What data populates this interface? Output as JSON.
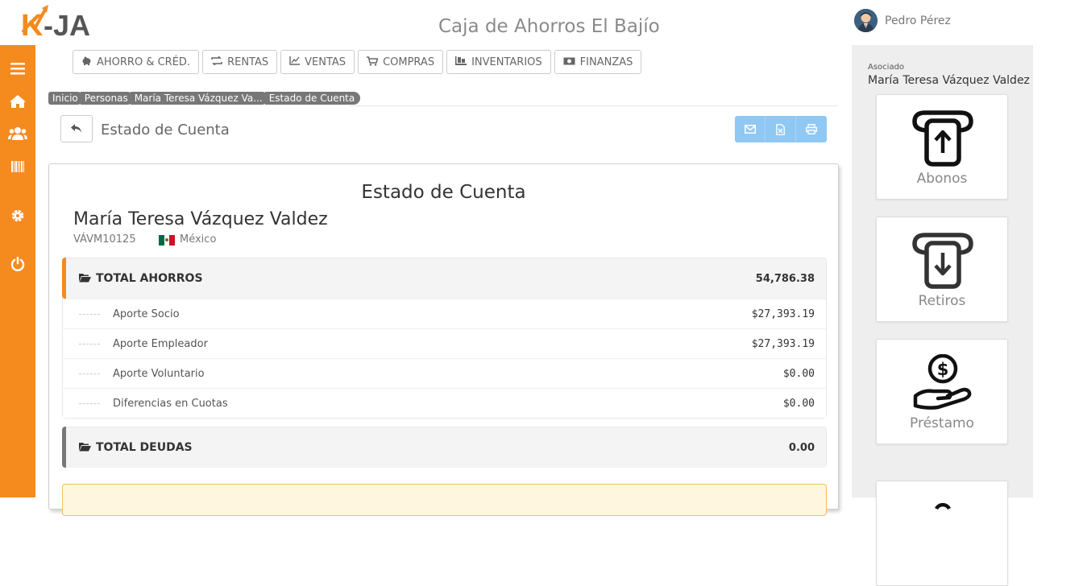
{
  "header": {
    "logo_text": "K-JA",
    "app_title": "Caja de Ahorros El Bajío",
    "user_name": "Pedro Pérez"
  },
  "colors": {
    "sidebar": "#f58a1f",
    "accent_ahorros": "#f58a1f",
    "accent_deudas": "#777777",
    "action_buttons": "#90c8f4"
  },
  "sidebar": {
    "items": [
      {
        "icon": "menu-icon"
      },
      {
        "icon": "home-icon"
      },
      {
        "icon": "users-icon"
      },
      {
        "icon": "barcode-icon"
      },
      {
        "icon": "gear-icon"
      },
      {
        "icon": "power-icon"
      }
    ]
  },
  "modules": [
    {
      "label": "AHORRO & CRÉD.",
      "icon": "piggy-bank-icon"
    },
    {
      "label": "RENTAS",
      "icon": "exchange-icon"
    },
    {
      "label": "VENTAS",
      "icon": "chart-line-icon"
    },
    {
      "label": "COMPRAS",
      "icon": "cart-icon"
    },
    {
      "label": "INVENTARIOS",
      "icon": "pallet-icon"
    },
    {
      "label": "FINANZAS",
      "icon": "money-icon"
    }
  ],
  "breadcrumb": [
    "Inicio",
    "Personas",
    "María Teresa Vázquez Va...",
    "Estado de Cuenta"
  ],
  "page": {
    "title": "Estado de Cuenta",
    "actions": [
      {
        "icon": "envelope-icon"
      },
      {
        "icon": "excel-icon"
      },
      {
        "icon": "print-icon"
      }
    ]
  },
  "statement": {
    "title": "Estado de Cuenta",
    "person_name": "María Teresa Vázquez Valdez",
    "person_id": "VÁVM10125",
    "country": "México",
    "groups": [
      {
        "label": "TOTAL AHORROS",
        "value": "54,786.38",
        "items": [
          {
            "label": "Aporte Socio",
            "value": "$27,393.19"
          },
          {
            "label": "Aporte Empleador",
            "value": "$27,393.19"
          },
          {
            "label": "Aporte Voluntario",
            "value": "$0.00"
          },
          {
            "label": "Diferencias en Cuotas",
            "value": "$0.00"
          }
        ]
      },
      {
        "label": "TOTAL DEUDAS",
        "value": "0.00",
        "items": []
      }
    ]
  },
  "right_panel": {
    "label": "Asociado",
    "name": "María Teresa Vázquez Valdez",
    "cards": [
      {
        "label": "Abonos",
        "icon": "deposit-icon"
      },
      {
        "label": "Retiros",
        "icon": "withdraw-icon"
      },
      {
        "label": "Préstamo",
        "icon": "loan-hand-icon"
      },
      {
        "label": "",
        "icon": "partial-card-icon"
      }
    ]
  }
}
